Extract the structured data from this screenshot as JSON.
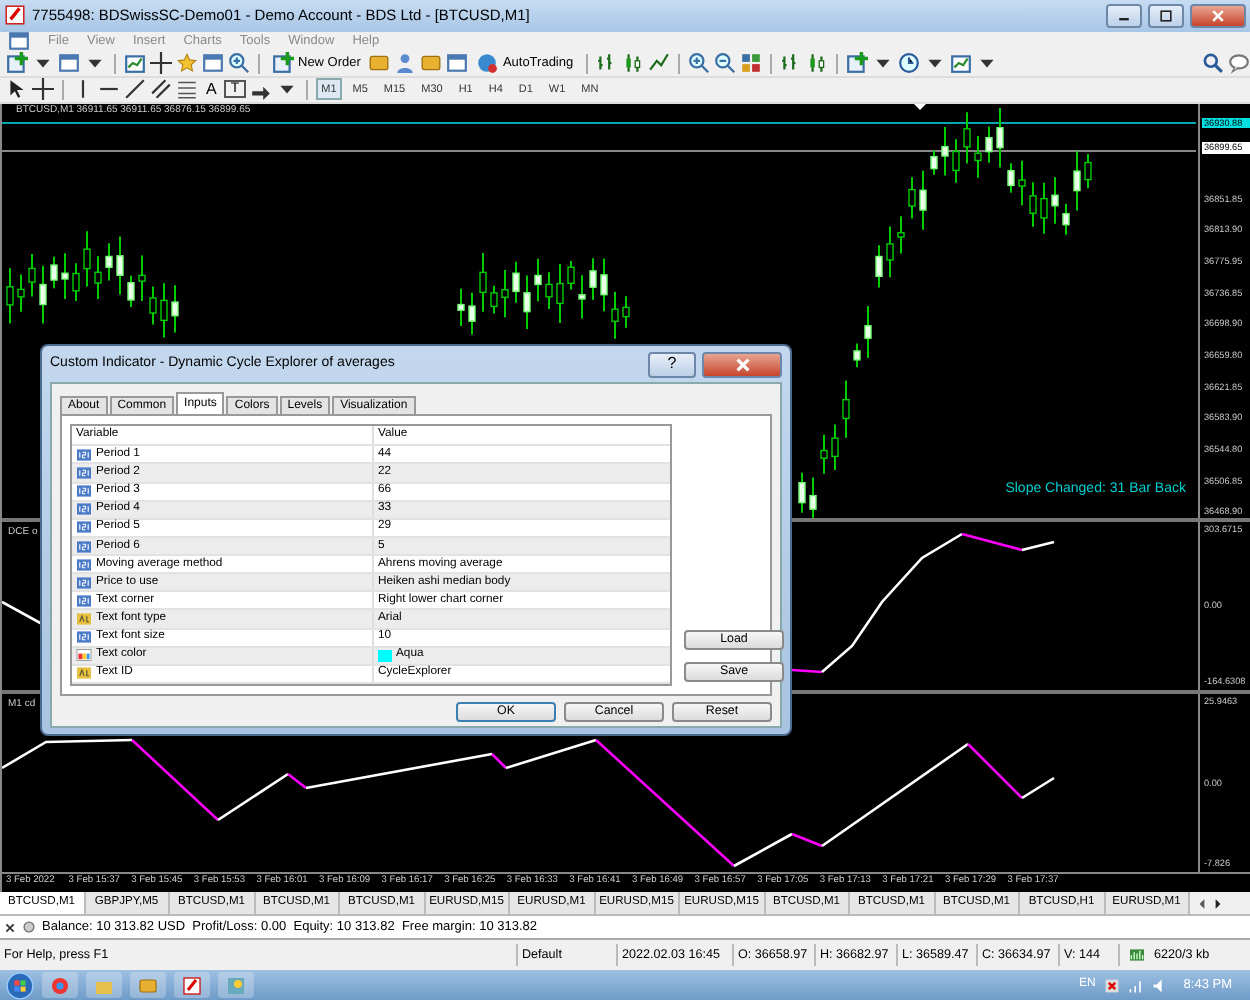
{
  "window": {
    "title": "7755498: BDSwissSC-Demo01 - Demo Account - BDS Ltd - [BTCUSD,M1]"
  },
  "menu": [
    "File",
    "View",
    "Insert",
    "Charts",
    "Tools",
    "Window",
    "Help"
  ],
  "toolbar": {
    "new_order": "New Order",
    "auto_trading": "AutoTrading"
  },
  "drawing_toolbar": {
    "text_tool": "A",
    "label_tool": "T"
  },
  "timeframes": [
    {
      "label": "M1",
      "selected": true
    },
    {
      "label": "M5",
      "selected": false
    },
    {
      "label": "M15",
      "selected": false
    },
    {
      "label": "M30",
      "selected": false
    },
    {
      "label": "H1",
      "selected": false
    },
    {
      "label": "H4",
      "selected": false
    },
    {
      "label": "D1",
      "selected": false
    },
    {
      "label": "W1",
      "selected": false
    },
    {
      "label": "MN",
      "selected": false
    }
  ],
  "chart": {
    "header": "BTCUSD,M1  36911.65 36911.65 36876.15 36899.65",
    "price_scale": [
      {
        "label": "36930.88",
        "kind": "ask"
      },
      {
        "label": "36899.65",
        "kind": "bid"
      },
      {
        "label": "36851.85",
        "kind": "tick"
      },
      {
        "label": "36813.90",
        "kind": "tick"
      },
      {
        "label": "36775.95",
        "kind": "tick"
      },
      {
        "label": "36736.85",
        "kind": "tick"
      },
      {
        "label": "36698.90",
        "kind": "tick"
      },
      {
        "label": "36659.80",
        "kind": "tick"
      },
      {
        "label": "36621.85",
        "kind": "tick"
      },
      {
        "label": "36583.90",
        "kind": "tick"
      },
      {
        "label": "36544.80",
        "kind": "tick"
      },
      {
        "label": "36506.85",
        "kind": "tick"
      },
      {
        "label": "36468.90",
        "kind": "tick"
      }
    ],
    "slope_text": "Slope Changed: 31 Bar Back",
    "indicator_1": {
      "label": "DCE o",
      "scale": [
        "303.6715",
        "0.00",
        "-164.6308"
      ]
    },
    "indicator_2": {
      "label": "M1 cd",
      "scale": [
        "25.9463",
        "0.00",
        "-7.826"
      ]
    },
    "time_axis": [
      "3 Feb 2022",
      "3 Feb 15:37",
      "3 Feb 15:45",
      "3 Feb 15:53",
      "3 Feb 16:01",
      "3 Feb 16:09",
      "3 Feb 16:17",
      "3 Feb 16:25",
      "3 Feb 16:33",
      "3 Feb 16:41",
      "3 Feb 16:49",
      "3 Feb 16:57",
      "3 Feb 17:05",
      "3 Feb 17:13",
      "3 Feb 17:21",
      "3 Feb 17:29",
      "3 Feb 17:37"
    ]
  },
  "dialog": {
    "title": "Custom Indicator - Dynamic Cycle Explorer of averages",
    "help_button": "?",
    "tabs": [
      {
        "label": "About",
        "selected": false
      },
      {
        "label": "Common",
        "selected": false
      },
      {
        "label": "Inputs",
        "selected": true
      },
      {
        "label": "Colors",
        "selected": false
      },
      {
        "label": "Levels",
        "selected": false
      },
      {
        "label": "Visualization",
        "selected": false
      }
    ],
    "columns": [
      "Variable",
      "Value"
    ],
    "rows": [
      {
        "kind": "int",
        "variable": "Period 1",
        "value": "44"
      },
      {
        "kind": "int",
        "variable": "Period 2",
        "value": "22"
      },
      {
        "kind": "int",
        "variable": "Period 3",
        "value": "66"
      },
      {
        "kind": "int",
        "variable": "Period 4",
        "value": "33"
      },
      {
        "kind": "int",
        "variable": "Period 5",
        "value": "29"
      },
      {
        "kind": "int",
        "variable": "Period 6",
        "value": "5"
      },
      {
        "kind": "int",
        "variable": "Moving average method",
        "value": "Ahrens moving average"
      },
      {
        "kind": "int",
        "variable": "Price to use",
        "value": "Heiken ashi median body"
      },
      {
        "kind": "int",
        "variable": "Text corner",
        "value": "Right lower chart corner"
      },
      {
        "kind": "string",
        "variable": "Text font type",
        "value": "Arial"
      },
      {
        "kind": "int",
        "variable": "Text font size",
        "value": "10"
      },
      {
        "kind": "color",
        "variable": "Text color",
        "value": "Aqua",
        "color": "#00ffff"
      },
      {
        "kind": "string",
        "variable": "Text ID",
        "value": "CycleExplorer"
      }
    ],
    "side_buttons": [
      "Load",
      "Save"
    ],
    "buttons": [
      "OK",
      "Cancel",
      "Reset"
    ]
  },
  "chart_tabs": [
    {
      "label": "BTCUSD,M1",
      "selected": true
    },
    {
      "label": "GBPJPY,M5",
      "selected": false
    },
    {
      "label": "BTCUSD,M1",
      "selected": false
    },
    {
      "label": "BTCUSD,M1",
      "selected": false
    },
    {
      "label": "BTCUSD,M1",
      "selected": false
    },
    {
      "label": "EURUSD,M15",
      "selected": false
    },
    {
      "label": "EURUSD,M1",
      "selected": false
    },
    {
      "label": "EURUSD,M15",
      "selected": false
    },
    {
      "label": "EURUSD,M15",
      "selected": false
    },
    {
      "label": "BTCUSD,M1",
      "selected": false
    },
    {
      "label": "BTCUSD,M1",
      "selected": false
    },
    {
      "label": "BTCUSD,M1",
      "selected": false
    },
    {
      "label": "BTCUSD,H1",
      "selected": false
    },
    {
      "label": "EURUSD,M1",
      "selected": false
    }
  ],
  "terminal": {
    "balance_line": "Balance: 10 313.82 USD  Profit/Loss: 0.00  Equity: 10 313.82  Free margin: 10 313.82"
  },
  "status_bar": [
    "For Help, press F1",
    "Default",
    "2022.02.03 16:45",
    "O: 36658.97",
    "H: 36682.97",
    "L: 36589.47",
    "C: 36634.97",
    "V: 144",
    "6220/3 kb"
  ],
  "taskbar": {
    "language": "EN",
    "clock": "8:43 PM"
  }
}
